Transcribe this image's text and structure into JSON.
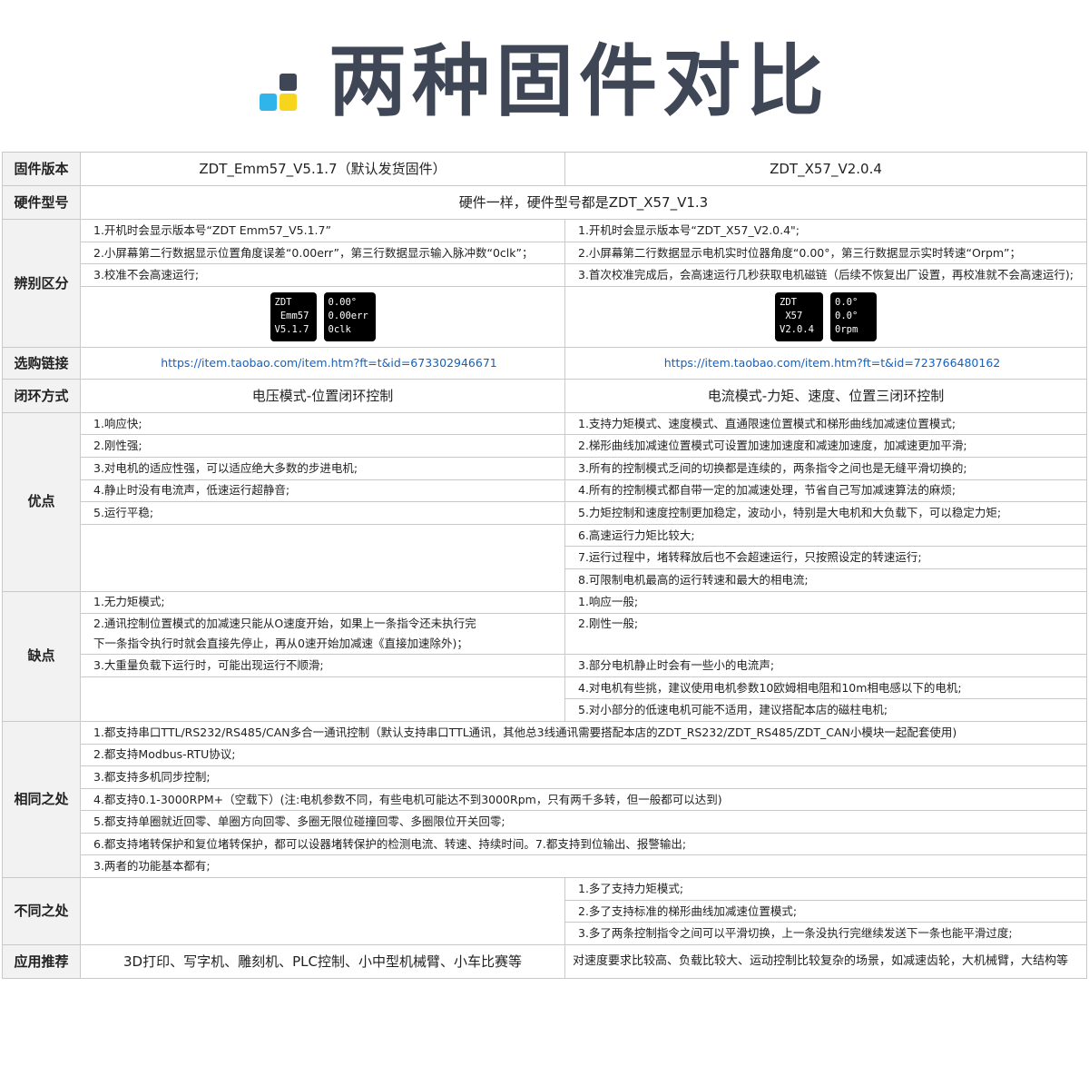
{
  "header": {
    "title": "两种固件对比"
  },
  "rows": {
    "version": {
      "label": "固件版本",
      "a": "ZDT_Emm57_V5.1.7（默认发货固件）",
      "b": "ZDT_X57_V2.0.4"
    },
    "hardware": {
      "label": "硬件型号",
      "value": "硬件一样，硬件型号都是ZDT_X57_V1.3"
    },
    "identify": {
      "label": "辨别区分",
      "a": [
        "1.开机时会显示版本号“ZDT Emm57_V5.1.7”",
        "2.小屏幕第二行数据显示位置角度误差“0.00err”，第三行数据显示输入脉冲数“0clk”；",
        "3.校准不会高速运行;"
      ],
      "b": [
        "1.开机时会显示版本号“ZDT_X57_V2.0.4\";",
        "2.小屏幕第二行数据显示电机实时位器角度“0.00°，第三行数据显示实时转速“Orpm”；",
        "3.首次校准完成后，会高速运行几秒获取电机磁链（后续不恢复出厂设置，再校准就不会高速运行);"
      ],
      "screens_a": [
        [
          "ZDT",
          " Emm57",
          "V5.1.7"
        ],
        [
          "0.00°",
          "0.00err",
          "0clk"
        ]
      ],
      "screens_b": [
        [
          "ZDT",
          " X57",
          "V2.0.4"
        ],
        [
          "0.0°",
          "0.0°",
          "0rpm"
        ]
      ]
    },
    "link": {
      "label": "选购链接",
      "a": "https://item.taobao.com/item.htm?ft=t&id=673302946671",
      "b": "https://item.taobao.com/item.htm?ft=t&id=723766480162"
    },
    "loop": {
      "label": "闭环方式",
      "a": "电压模式-位置闭环控制",
      "b": "电流模式-力矩、速度、位置三闭环控制"
    },
    "pros": {
      "label": "优点",
      "a": [
        "1.响应快;",
        "2.刚性强;",
        "3.对电机的适应性强，可以适应绝大多数的步进电机;",
        "4.静止时没有电流声，低速运行超静音;",
        "5.运行平稳;"
      ],
      "b": [
        "1.支持力矩模式、速度模式、直通限速位置模式和梯形曲线加减速位置模式;",
        "2.梯形曲线加减速位置模式可设置加速加速度和减速加速度，加减速更加平滑;",
        "3.所有的控制模式乏间的切换都是连续的，两条指令之间也是无缝平滑切换的;",
        "4.所有的控制模式都自带一定的加减速处理，节省自己写加减速算法的麻烦;",
        "5.力矩控制和速度控制更加稳定，波动小，特别是大电机和大负载下，可以稳定力矩;",
        "6.高速运行力矩比较大;",
        "7.运行过程中，堵转释放后也不会超速运行，只按照设定的转速运行;",
        "8.可限制电机最高的运行转速和最大的相电流;"
      ]
    },
    "cons": {
      "label": "缺点",
      "a": [
        "1.无力矩模式;",
        "2.通讯控制位置模式的加减速只能从O速度开始，如果上一条指令还未执行完",
        "下一条指令执行时就会直接先停止，再从0速开始加减速《直接加速除外)；",
        "3.大重量负载下运行时，可能出现运行不顺滑;"
      ],
      "b": [
        "1.响应一般;",
        "2.刚性一般;",
        "3.部分电机静止时会有一些小的电流声;",
        "4.对电机有些挑，建议使用电机参数10欧姆相电阻和10m相电感以下的电机;",
        "5.对小部分的低速电机可能不适用，建议搭配本店的磁柱电机;"
      ]
    },
    "same": {
      "label": "相同之处",
      "items": [
        "1.都支持串口TTL/RS232/RS485/CAN多合一通讯控制（默认支持串口TTL通讯，其他总3线通讯需要搭配本店的ZDT_RS232/ZDT_RS485/ZDT_CAN小模块一起配套使用)",
        "2.都支持Modbus-RTU协议;",
        "3.都支持多机同步控制;",
        "4.都支持0.1-3000RPM+（空载下）(注:电机参数不同，有些电机可能达不到3000Rpm，只有两千多转，但一般都可以达到)",
        "5.都支持单圈就近回零、单圈方向回零、多圈无限位碰撞回零、多圈限位开关回零;",
        "6.都支持堵转保护和复位堵转保护，都可以设器堵转保护的检测电流、转速、持续时间。7.都支持到位输出、报警输出;",
        "3.两者的功能基本都有;"
      ]
    },
    "diff": {
      "label": "不同之处",
      "b": [
        "1.多了支持力矩模式;",
        "2.多了支持标准的梯形曲线加减速位置模式;",
        "3.多了两条控制指令之间可以平滑切换，上一条没执行完继续发送下一条也能平滑过度;"
      ]
    },
    "apps": {
      "label": "应用推荐",
      "a": "3D打印、写字机、雕刻机、PLC控制、小中型机械臂、小车比赛等",
      "b": "对速度要求比较高、负载比较大、运动控制比较复杂的场景，如减速齿轮，大机械臂，大结构等"
    }
  }
}
